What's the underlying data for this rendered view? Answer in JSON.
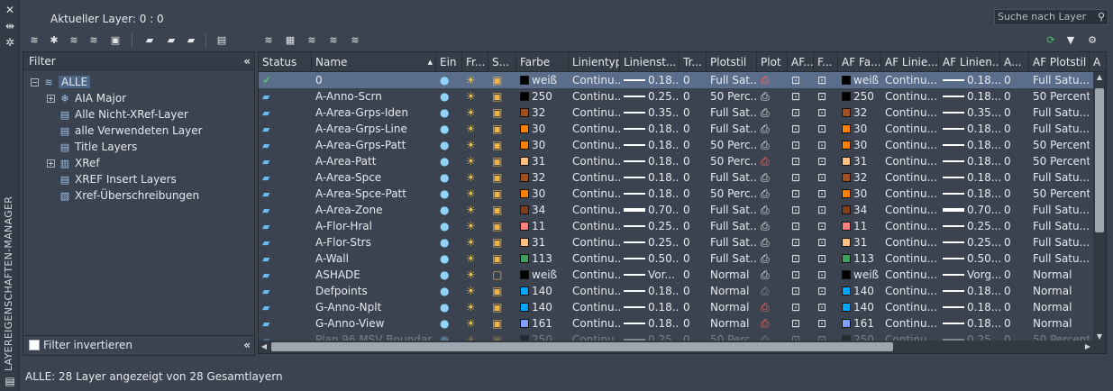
{
  "window": {
    "vertical_title": "LAYEREIGENSCHAFTEN-MANAGER",
    "current_layer": "Aktueller Layer: 0 : 0",
    "search_placeholder": "Suche nach Layer",
    "status_text": "ALLE: 28 Layer angezeigt von 28 Gesamtlayern"
  },
  "filter_pane": {
    "header": "Filter",
    "collapse_glyph": "«",
    "invert_label": "Filter invertieren",
    "tree": [
      {
        "label": "ALLE",
        "icon": "filter-stack-icon",
        "selected": true,
        "expander": "−"
      },
      {
        "label": "AIA Major",
        "icon": "group-filter-icon",
        "expander": "+"
      },
      {
        "label": "Alle Nicht-XRef-Layer",
        "icon": "property-filter-icon"
      },
      {
        "label": "alle Verwendeten Layer",
        "icon": "property-filter-icon"
      },
      {
        "label": "Title Layers",
        "icon": "property-filter-icon"
      },
      {
        "label": "XRef",
        "icon": "xref-filter-icon",
        "expander": "+"
      },
      {
        "label": "XREF Insert Layers",
        "icon": "property-filter-icon"
      },
      {
        "label": "Xref-Überschreibungen",
        "icon": "xref-override-icon"
      }
    ]
  },
  "columns": [
    "Status",
    "Name",
    "Ein",
    "Fr...",
    "S...",
    "Farbe",
    "Linientyp",
    "Linienst...",
    "Tr...",
    "Plotstil",
    "Plot",
    "AF...",
    "F...",
    "AF Fa...",
    "AF Linie...",
    "AF Linien...",
    "A...",
    "AF Plotstil",
    "A"
  ],
  "rows": [
    {
      "status": "current",
      "name": "0",
      "color": "weiß",
      "hex": "#000000",
      "ltype": "Continu...",
      "lw": "0.18...",
      "lwthick": false,
      "tr": "0",
      "pstyle": "Full Sat...",
      "plot": "noplot",
      "vpcolor": "weiß",
      "vplt": "Continu...",
      "vplw": "0.18...",
      "vptr": "0",
      "vpps": "Full Satu...",
      "a": "A",
      "lock": "locked",
      "sel": true
    },
    {
      "status": "layer",
      "name": "A-Anno-Scrn",
      "color": "250",
      "hex": "#000000",
      "ltype": "Continu...",
      "lw": "0.25...",
      "lwthick": false,
      "tr": "0",
      "pstyle": "50 Perc...",
      "plot": "print",
      "vpcolor": "250",
      "vplt": "Continu...",
      "vplw": "0.18...",
      "vptr": "0",
      "vpps": "50 Percent",
      "a": "A",
      "lock": "locked"
    },
    {
      "status": "layer",
      "name": "A-Area-Grps-Iden",
      "color": "32",
      "hex": "#a0501e",
      "ltype": "Continu...",
      "lw": "0.35...",
      "lwthick": false,
      "tr": "0",
      "pstyle": "Full Sat...",
      "plot": "print",
      "vpcolor": "32",
      "vplt": "Continu...",
      "vplw": "0.35...",
      "vptr": "0",
      "vpps": "Full Satu...",
      "a": "A",
      "lock": "locked"
    },
    {
      "status": "layer",
      "name": "A-Area-Grps-Line",
      "color": "30",
      "hex": "#ff7f00",
      "ltype": "Continu...",
      "lw": "0.18...",
      "lwthick": false,
      "tr": "0",
      "pstyle": "Full Sat...",
      "plot": "print",
      "vpcolor": "30",
      "vplt": "Continu...",
      "vplw": "0.18...",
      "vptr": "0",
      "vpps": "Full Satu...",
      "a": "A",
      "lock": "locked"
    },
    {
      "status": "layer",
      "name": "A-Area-Grps-Patt",
      "color": "30",
      "hex": "#ff7f00",
      "ltype": "Continu...",
      "lw": "0.18...",
      "lwthick": false,
      "tr": "0",
      "pstyle": "50 Perc...",
      "plot": "print",
      "vpcolor": "30",
      "vplt": "Continu...",
      "vplw": "0.18...",
      "vptr": "0",
      "vpps": "50 Percent",
      "a": "A",
      "lock": "locked"
    },
    {
      "status": "layer",
      "name": "A-Area-Patt",
      "color": "31",
      "hex": "#ffbf7f",
      "ltype": "Continu...",
      "lw": "0.18...",
      "lwthick": false,
      "tr": "0",
      "pstyle": "50 Perc...",
      "plot": "noplot",
      "vpcolor": "31",
      "vplt": "Continu...",
      "vplw": "0.18...",
      "vptr": "0",
      "vpps": "50 Percent",
      "a": "A",
      "lock": "locked"
    },
    {
      "status": "layer",
      "name": "A-Area-Spce",
      "color": "32",
      "hex": "#a0501e",
      "ltype": "Continu...",
      "lw": "0.18...",
      "lwthick": false,
      "tr": "0",
      "pstyle": "Full Sat...",
      "plot": "print",
      "vpcolor": "32",
      "vplt": "Continu...",
      "vplw": "0.18...",
      "vptr": "0",
      "vpps": "Full Satu...",
      "a": "A",
      "lock": "locked"
    },
    {
      "status": "layer",
      "name": "A-Area-Spce-Patt",
      "color": "30",
      "hex": "#ff7f00",
      "ltype": "Continu...",
      "lw": "0.18...",
      "lwthick": false,
      "tr": "0",
      "pstyle": "50 Perc...",
      "plot": "print",
      "vpcolor": "30",
      "vplt": "Continu...",
      "vplw": "0.18...",
      "vptr": "0",
      "vpps": "50 Percent",
      "a": "A",
      "lock": "locked"
    },
    {
      "status": "layer",
      "name": "A-Area-Zone",
      "color": "34",
      "hex": "#7f3f1f",
      "ltype": "Continu...",
      "lw": "0.70...",
      "lwthick": true,
      "tr": "0",
      "pstyle": "Full Sat...",
      "plot": "print",
      "vpcolor": "34",
      "vplt": "Continu...",
      "vplw": "0.70...",
      "vptr": "0",
      "vpps": "Full Satu...",
      "a": "A",
      "lock": "locked"
    },
    {
      "status": "layer",
      "name": "A-Flor-Hral",
      "color": "11",
      "hex": "#ff7f7f",
      "ltype": "Continu...",
      "lw": "0.25...",
      "lwthick": false,
      "tr": "0",
      "pstyle": "Full Sat...",
      "plot": "print",
      "vpcolor": "11",
      "vplt": "Continu...",
      "vplw": "0.25...",
      "vptr": "0",
      "vpps": "Full Satu...",
      "a": "A",
      "lock": "locked"
    },
    {
      "status": "layer",
      "name": "A-Flor-Strs",
      "color": "31",
      "hex": "#ffbf7f",
      "ltype": "Continu...",
      "lw": "0.25...",
      "lwthick": false,
      "tr": "0",
      "pstyle": "Full Sat...",
      "plot": "print",
      "vpcolor": "31",
      "vplt": "Continu...",
      "vplw": "0.25...",
      "vptr": "0",
      "vpps": "Full Satu...",
      "a": "A",
      "lock": "locked"
    },
    {
      "status": "layer",
      "name": "A-Wall",
      "color": "113",
      "hex": "#3f9f5f",
      "ltype": "Continu...",
      "lw": "0.50...",
      "lwthick": false,
      "tr": "0",
      "pstyle": "Full Sat...",
      "plot": "print",
      "vpcolor": "113",
      "vplt": "Continu...",
      "vplw": "0.50...",
      "vptr": "0",
      "vpps": "Full Satu...",
      "a": "A",
      "lock": "locked"
    },
    {
      "status": "layer",
      "name": "ASHADE",
      "color": "weiß",
      "hex": "#000000",
      "ltype": "Continu...",
      "lw": "Vor...",
      "lwthick": false,
      "tr": "0",
      "pstyle": "Normal",
      "plot": "print",
      "vpcolor": "weiß",
      "vplt": "Continu...",
      "vplw": "Vorg...",
      "vptr": "0",
      "vpps": "Normal",
      "a": "A",
      "lock": "unlocked"
    },
    {
      "status": "layer",
      "name": "Defpoints",
      "color": "140",
      "hex": "#00a5ff",
      "ltype": "Continu...",
      "lw": "0.18...",
      "lwthick": false,
      "tr": "0",
      "pstyle": "Normal",
      "plot": "grey",
      "vpcolor": "140",
      "vplt": "Continu...",
      "vplw": "0.18...",
      "vptr": "0",
      "vpps": "Normal",
      "a": "D",
      "lock": "locked"
    },
    {
      "status": "layer",
      "name": "G-Anno-Nplt",
      "color": "140",
      "hex": "#00a5ff",
      "ltype": "Continu...",
      "lw": "0.18...",
      "lwthick": false,
      "tr": "0",
      "pstyle": "Normal",
      "plot": "noplot",
      "vpcolor": "140",
      "vplt": "Continu...",
      "vplw": "0.18...",
      "vptr": "0",
      "vpps": "Normal",
      "a": "C",
      "lock": "locked"
    },
    {
      "status": "layer",
      "name": "G-Anno-View",
      "color": "161",
      "hex": "#7f9fff",
      "ltype": "Continu...",
      "lw": "0.18...",
      "lwthick": false,
      "tr": "0",
      "pstyle": "Normal",
      "plot": "noplot",
      "vpcolor": "161",
      "vplt": "Continu...",
      "vplw": "0.18...",
      "vptr": "0",
      "vpps": "Normal",
      "a": "A",
      "lock": "locked"
    },
    {
      "status": "layer",
      "name": "Plan 96 MSV Boundar",
      "color": "250",
      "hex": "#000000",
      "ltype": "Continu...",
      "lw": "0.25...",
      "lwthick": false,
      "tr": "0",
      "pstyle": "50 Perc...",
      "plot": "print",
      "vpcolor": "250",
      "vplt": "Continu...",
      "vplw": "0.25...",
      "vptr": "0",
      "vpps": "50 Percent",
      "a": "A",
      "lock": "locked",
      "partial": true
    }
  ]
}
